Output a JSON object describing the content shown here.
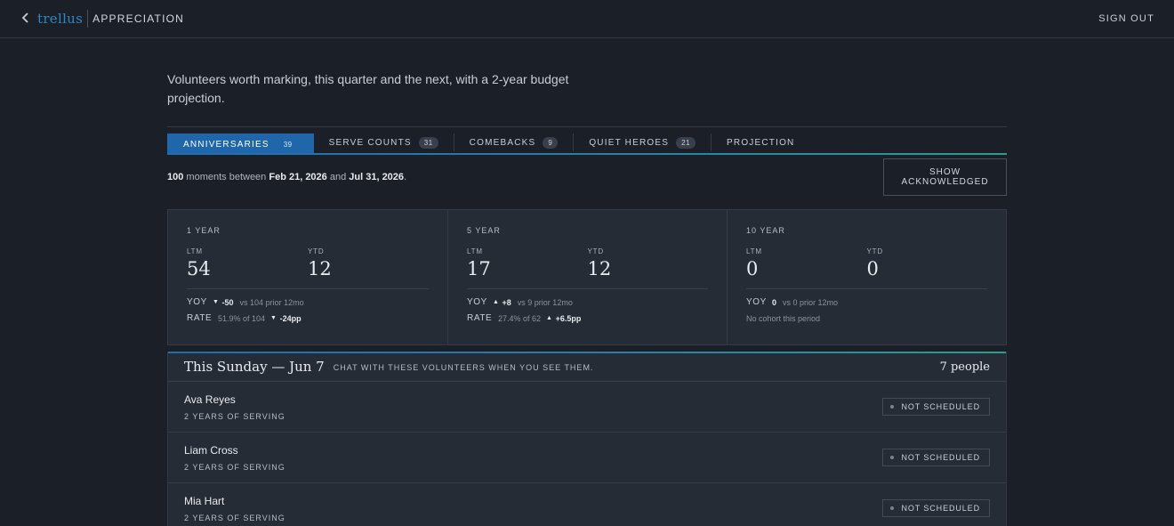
{
  "header": {
    "back_icon": "chevron-left-icon",
    "logo": "trellus",
    "section": "APPRECIATION",
    "sign_out": "SIGN OUT"
  },
  "intro": "Volunteers worth marking, this quarter and the next, with a 2-year budget projection.",
  "tabs": [
    {
      "label": "ANNIVERSARIES",
      "count": "39",
      "active": true
    },
    {
      "label": "SERVE COUNTS",
      "count": "31"
    },
    {
      "label": "COMEBACKS",
      "count": "9"
    },
    {
      "label": "QUIET HEROES",
      "count": "21"
    },
    {
      "label": "PROJECTION",
      "count": ""
    }
  ],
  "summary": {
    "count": "100",
    "text1": " moments between ",
    "start": "Feb 21, 2026",
    "text2": " and ",
    "end": "Jul 31, 2026",
    "text3": "."
  },
  "show_acknowledged": "SHOW ACKNOWLEDGED",
  "stats": [
    {
      "title": "1 YEAR",
      "ltm_label": "LTM",
      "ltm": "54",
      "ytd_label": "YTD",
      "ytd": "12",
      "yoy_label": "YOY",
      "yoy_dir": "▼",
      "yoy_delta": "-50",
      "yoy_sub": "vs 104 prior 12mo",
      "rate_label": "RATE",
      "rate_sub": "51.9% of 104",
      "rate_dir": "▼",
      "rate_delta": "-24pp"
    },
    {
      "title": "5 YEAR",
      "ltm_label": "LTM",
      "ltm": "17",
      "ytd_label": "YTD",
      "ytd": "12",
      "yoy_label": "YOY",
      "yoy_dir": "▲",
      "yoy_delta": "+8",
      "yoy_sub": "vs 9 prior 12mo",
      "rate_label": "RATE",
      "rate_sub": "27.4% of 62",
      "rate_dir": "▲",
      "rate_delta": "+6.5pp"
    },
    {
      "title": "10 YEAR",
      "ltm_label": "LTM",
      "ltm": "0",
      "ytd_label": "YTD",
      "ytd": "0",
      "yoy_label": "YOY",
      "yoy_dir": "",
      "yoy_delta": "0",
      "yoy_sub": "vs 0 prior 12mo",
      "note": "No cohort this period"
    }
  ],
  "panel": {
    "title": "This Sunday — Jun 7",
    "subtitle": "CHAT WITH THESE VOLUNTEERS WHEN YOU SEE THEM.",
    "count": "7 people",
    "rows": [
      {
        "name": "Ava Reyes",
        "tenure": "2 YEARS OF SERVING",
        "status": "NOT SCHEDULED"
      },
      {
        "name": "Liam Cross",
        "tenure": "2 YEARS OF SERVING",
        "status": "NOT SCHEDULED"
      },
      {
        "name": "Mia Hart",
        "tenure": "2 YEARS OF SERVING",
        "status": "NOT SCHEDULED"
      }
    ]
  }
}
